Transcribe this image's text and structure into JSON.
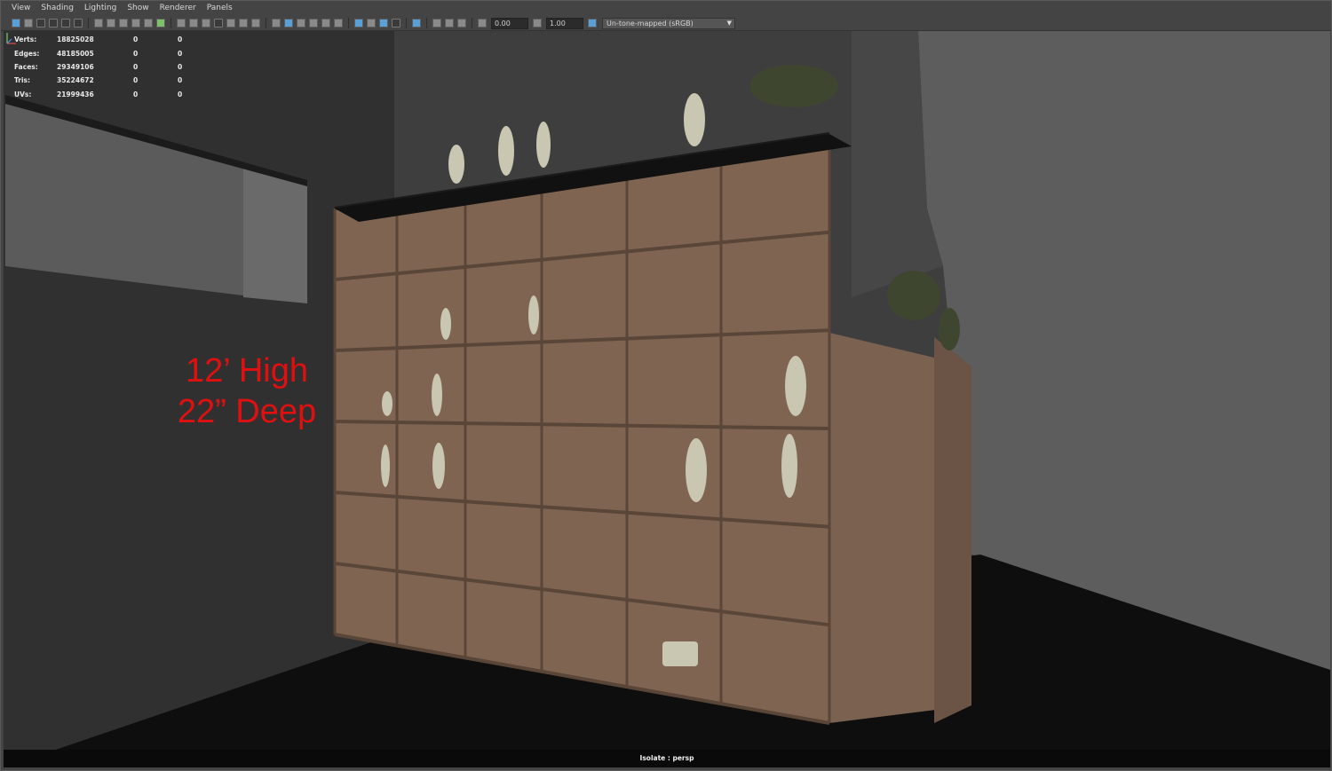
{
  "menu": [
    "View",
    "Shading",
    "Lighting",
    "Show",
    "Renderer",
    "Panels"
  ],
  "toolbar": {
    "exposure_value": "0.00",
    "gamma_value": "1.00",
    "color_space": "Un-tone-mapped (sRGB)",
    "colors": {
      "accent": "#5aa0d8",
      "active": "#7fc06a"
    }
  },
  "hud": {
    "rows": [
      {
        "label": "Verts:",
        "value": "18825028",
        "z1": "0",
        "z2": "0"
      },
      {
        "label": "Edges:",
        "value": "48185005",
        "z1": "0",
        "z2": "0"
      },
      {
        "label": "Faces:",
        "value": "29349106",
        "z1": "0",
        "z2": "0"
      },
      {
        "label": "Tris:",
        "value": "35224672",
        "z1": "0",
        "z2": "0"
      },
      {
        "label": "UVs:",
        "value": "21999436",
        "z1": "0",
        "z2": "0"
      }
    ]
  },
  "annotation": {
    "line1": "12’ High",
    "line2": "22” Deep",
    "color": "#e01010"
  },
  "camera_label": "Isolate : persp",
  "icons": [
    "select-tool-icon",
    "camera-icon",
    "grid-icon",
    "wireframe-icon",
    "smooth-shade-icon",
    "texture-icon",
    "light-icon",
    "isolate-icon",
    "exposure-icon",
    "gamma-icon",
    "color-management-icon",
    "chevron-down-icon",
    "axis-gizmo-icon"
  ]
}
